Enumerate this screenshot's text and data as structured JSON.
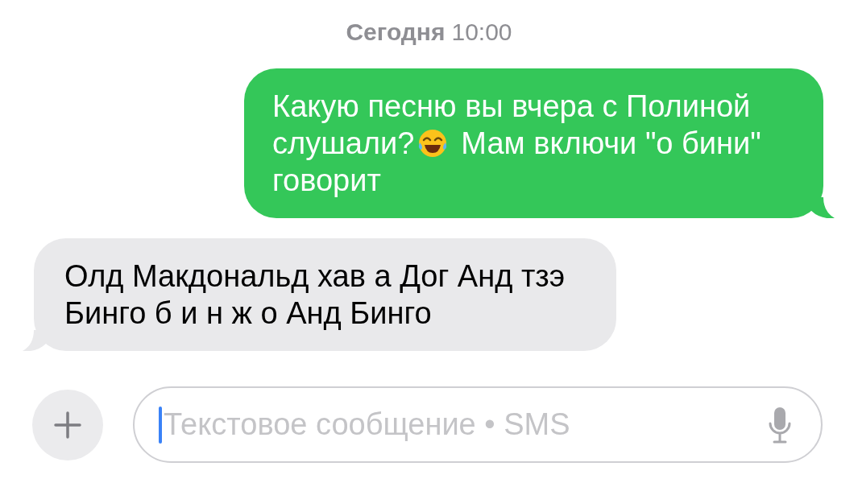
{
  "timestamp": {
    "day": "Сегодня",
    "time": "10:00"
  },
  "messages": [
    {
      "kind": "outgoing",
      "parts": [
        {
          "kind": "text",
          "text": "Какую песню вы вчера с Полиной"
        },
        {
          "kind": "text",
          "text": "слушали?"
        },
        {
          "kind": "emoji"
        },
        {
          "kind": "text",
          "text": "Мам включи \"о бини\""
        },
        {
          "kind": "text",
          "text": "говорит"
        }
      ]
    },
    {
      "kind": "incoming",
      "parts": [
        {
          "kind": "text",
          "text": "Олд Макдональд хав а Дог Анд тзэ Бинго б и н ж о Анд Бинго"
        }
      ]
    }
  ],
  "composer": {
    "placeholder": "Текстовое сообщение • SMS"
  }
}
